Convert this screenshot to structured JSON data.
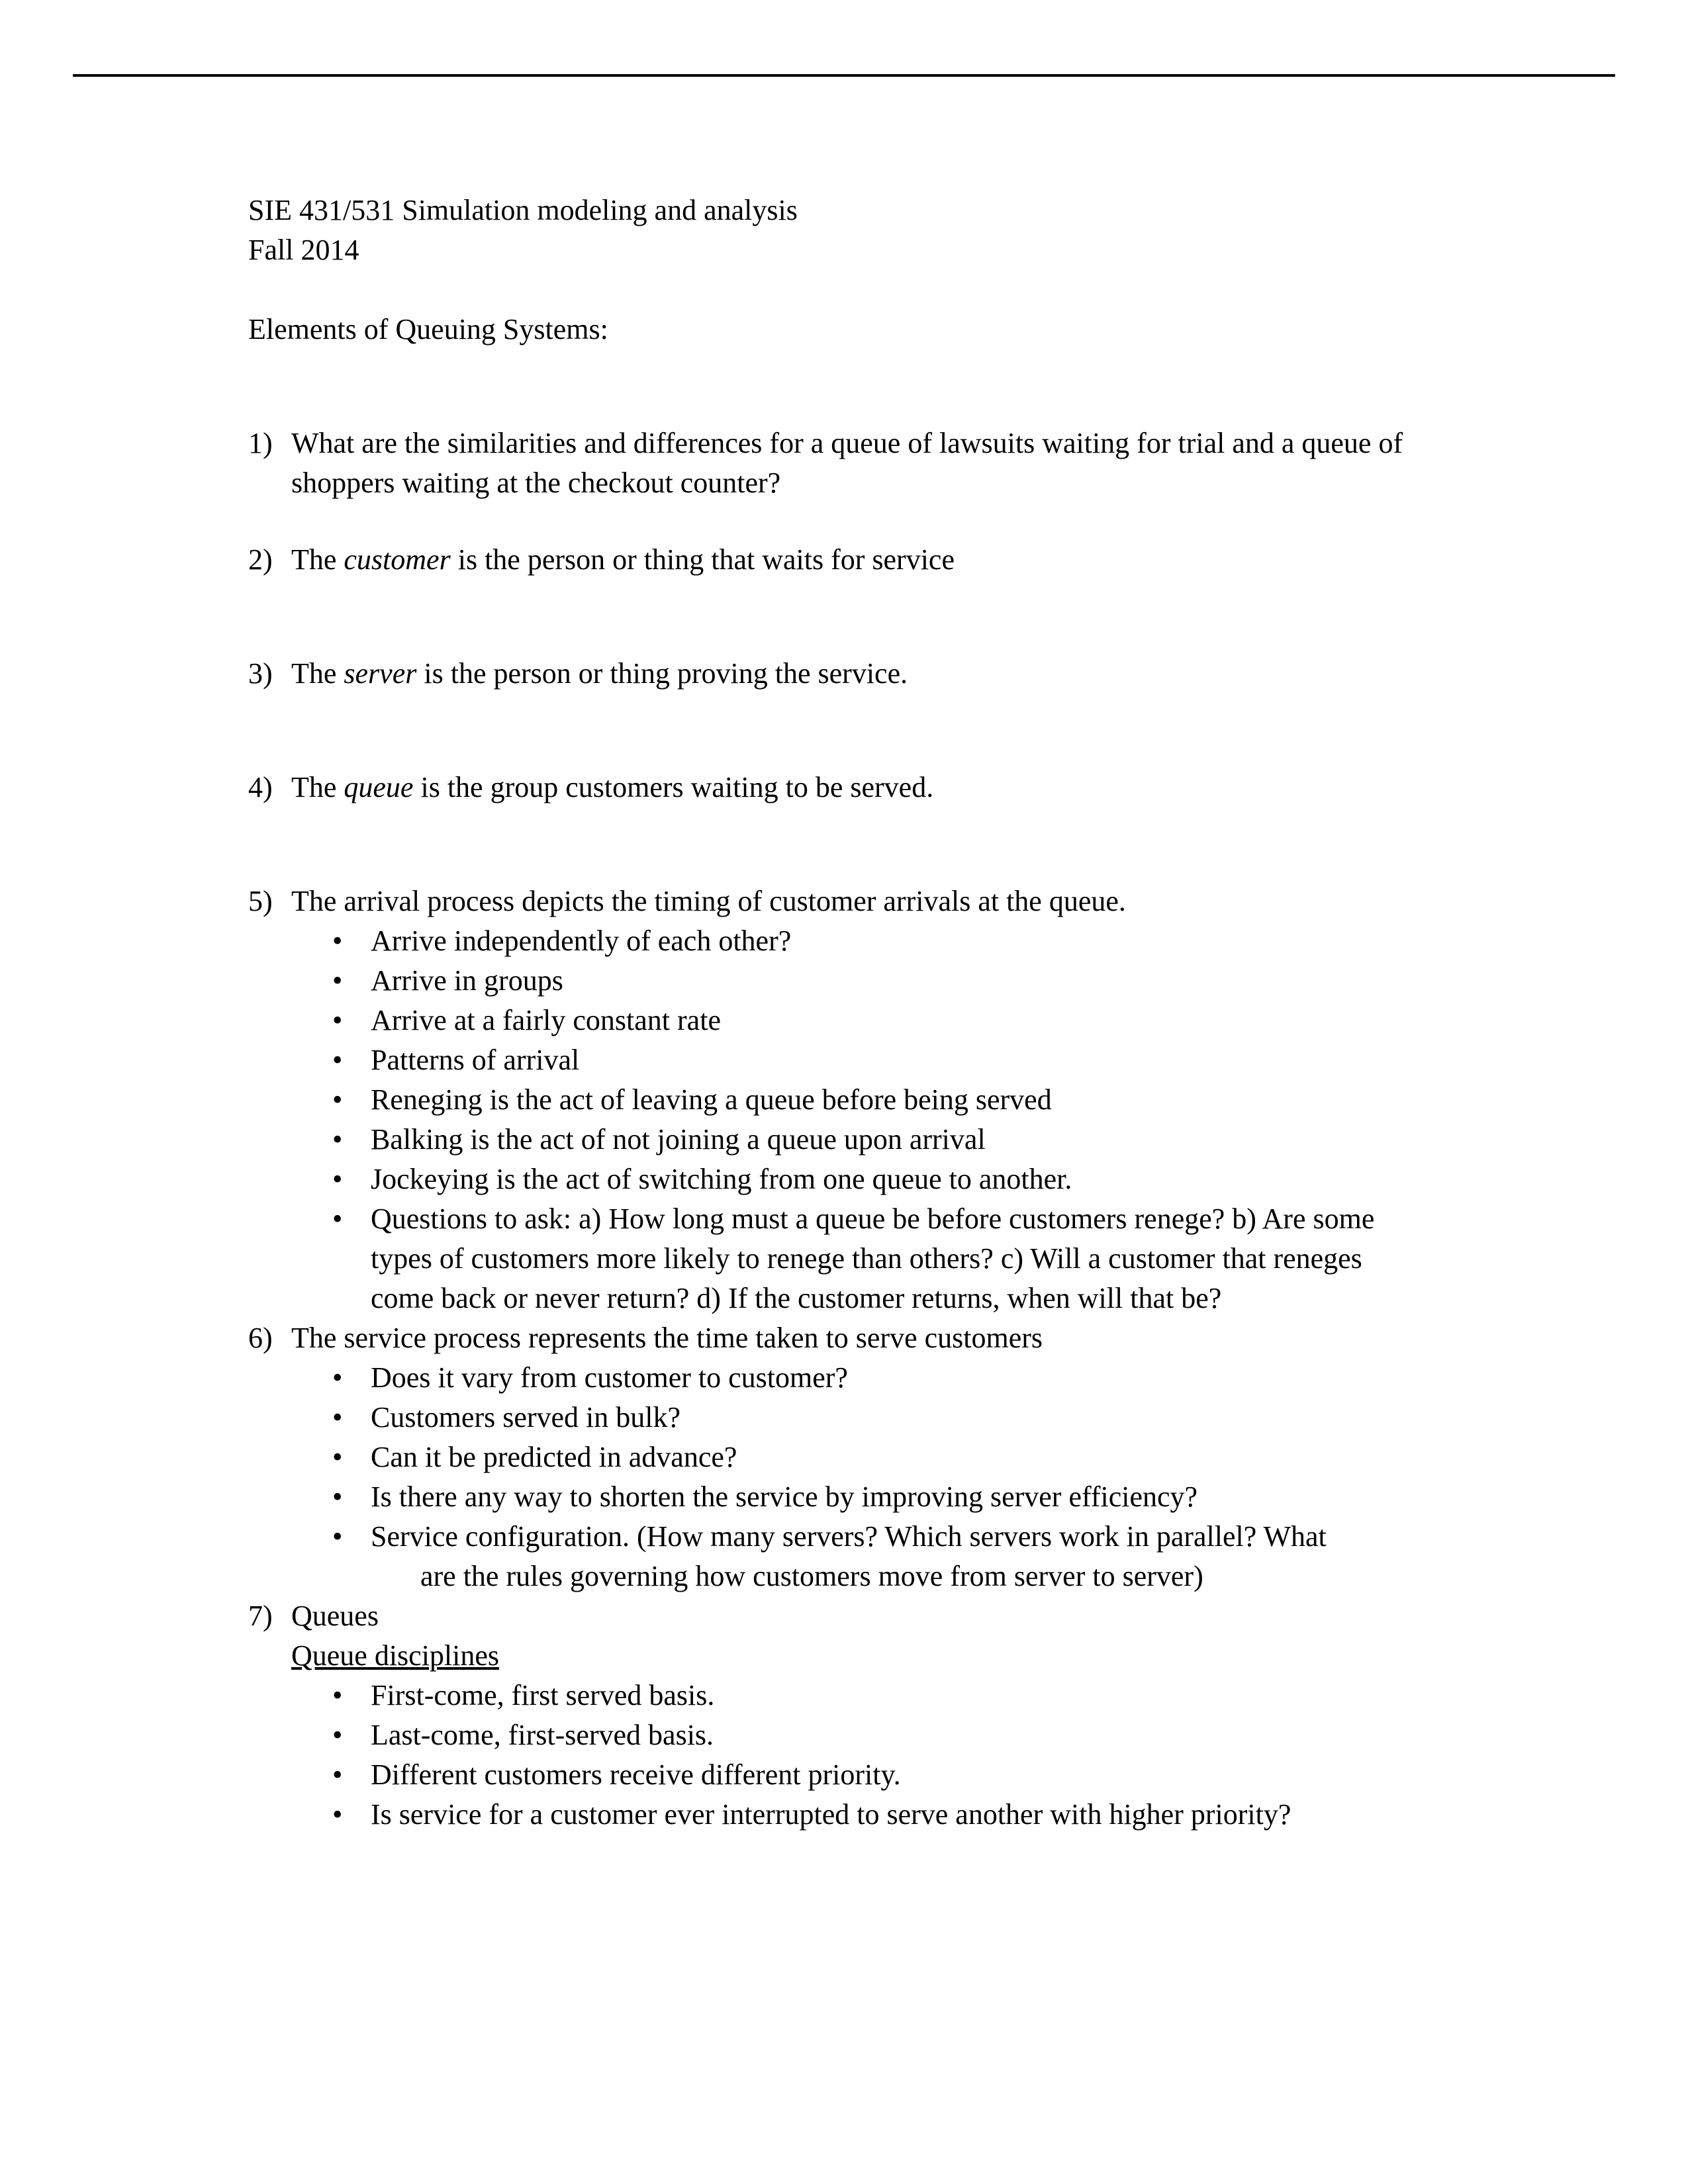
{
  "document": {
    "course_line": "SIE 431/531 Simulation modeling and analysis",
    "term_line": "Fall 2014",
    "section_title": "Elements of Queuing Systems:"
  },
  "items": {
    "i1": {
      "num": "1)",
      "text": "What are the similarities and differences for a queue of lawsuits waiting for trial and a queue of shoppers waiting at the checkout counter?"
    },
    "i2": {
      "num": "2)",
      "pre": "The ",
      "em": "customer",
      "post": " is the person or thing that waits for service"
    },
    "i3": {
      "num": "3)",
      "pre": "The ",
      "em": "server",
      "post": " is the person or thing proving the service."
    },
    "i4": {
      "num": "4)",
      "pre": "The ",
      "em": "queue",
      "post": " is the group customers waiting to be served."
    },
    "i5": {
      "num": "5)",
      "text": "The arrival process depicts the timing of customer arrivals at the queue.",
      "bullets": [
        "Arrive independently of each other?",
        "Arrive in groups",
        "Arrive at a fairly constant rate",
        "Patterns of arrival",
        "Reneging is the act of leaving a queue before being served",
        "Balking is the act of not joining a queue upon arrival",
        "Jockeying is the act of switching from one queue to another.",
        "Questions to ask: a) How long must a queue be before customers renege? b) Are some types of customers more likely to renege than others?  c) Will a customer that reneges come back or never return? d) If the customer returns, when will that be?"
      ]
    },
    "i6": {
      "num": "6)",
      "text": "The service process represents the time taken to serve customers",
      "bullets": [
        "Does it vary from customer to customer?",
        "Customers served in bulk?",
        "Can it be predicted in advance?",
        "Is there any way to shorten the service by improving server efficiency?"
      ],
      "config_bullet_line1": "Service configuration. (How many servers? Which servers work in parallel? What",
      "config_bullet_line2": "are the rules governing how customers move from server to server)"
    },
    "i7": {
      "num": "7)",
      "text": "Queues",
      "subheading": "Queue disciplines",
      "bullets": [
        "First-come, first served basis.",
        "Last-come, first-served basis.",
        "Different customers receive different priority.",
        "Is service for a customer ever interrupted to serve another with higher priority?"
      ]
    }
  }
}
